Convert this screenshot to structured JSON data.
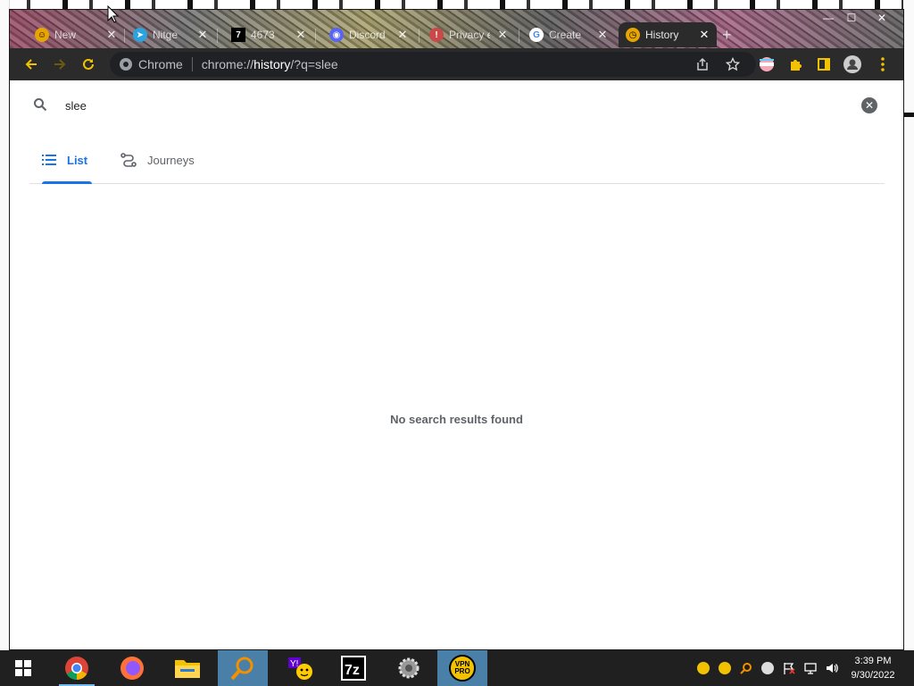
{
  "window": {
    "tabs": [
      {
        "title": "New",
        "favicon": "smiley-icon",
        "color": "#e8a400"
      },
      {
        "title": "Nitge",
        "favicon": "telegram-icon",
        "color": "#2aa3e0"
      },
      {
        "title": "4673",
        "favicon": "seven-icon",
        "color": "#ffffff"
      },
      {
        "title": "Discord",
        "favicon": "discord-icon",
        "color": "#5865f2"
      },
      {
        "title": "Privacy error",
        "favicon": "warning-icon",
        "color": "#c94848"
      },
      {
        "title": "Create",
        "favicon": "google-icon",
        "color": "#4285f4"
      },
      {
        "title": "History",
        "favicon": "history-icon",
        "color": "#e8a400"
      }
    ],
    "new_tab": "+",
    "controls": {
      "minimize": "—",
      "maximize": "☐",
      "close": "✕"
    }
  },
  "toolbar": {
    "site_label": "Chrome",
    "url_scheme": "chrome://",
    "url_host": "history",
    "url_rest": "/?q=slee"
  },
  "page": {
    "search_query": "slee",
    "tabs": [
      {
        "label": "List",
        "active": true
      },
      {
        "label": "Journeys",
        "active": false
      }
    ],
    "empty_message": "No search results found"
  },
  "taskbar": {
    "apps": [
      "windows-start",
      "chrome",
      "firefox",
      "file-explorer",
      "search-magnifier",
      "yahoo-messenger",
      "7zip",
      "settings-gear",
      "vpn-pro"
    ],
    "vpn_label": "VPN PRO",
    "clock_time": "3:39 PM",
    "clock_date": "9/30/2022"
  }
}
